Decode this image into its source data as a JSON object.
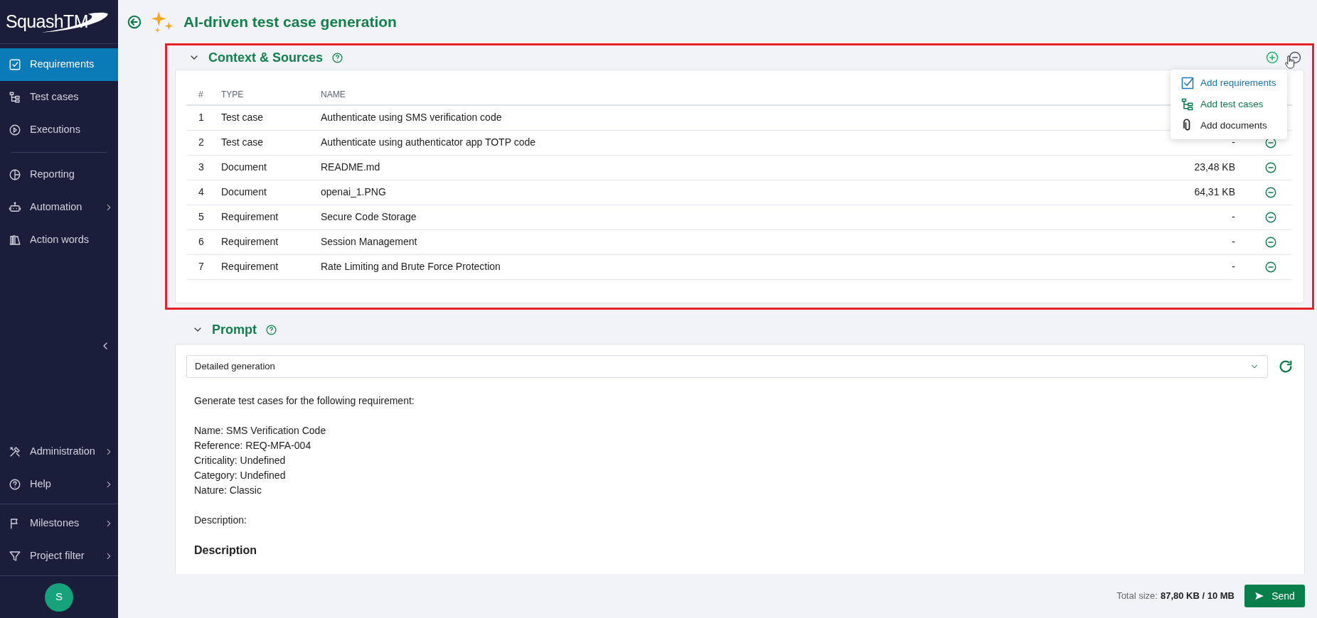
{
  "app": {
    "logo": "SquashTM",
    "avatar": "S"
  },
  "sidebar": {
    "sections": [
      [
        {
          "label": "Requirements",
          "selected": true,
          "submenu": false
        },
        {
          "label": "Test cases",
          "selected": false,
          "submenu": false
        },
        {
          "label": "Executions",
          "selected": false,
          "submenu": false
        }
      ],
      [
        {
          "label": "Reporting",
          "selected": false,
          "submenu": false
        },
        {
          "label": "Automation",
          "selected": false,
          "submenu": true
        },
        {
          "label": "Action words",
          "selected": false,
          "submenu": false
        }
      ],
      [
        {
          "label": "Administration",
          "selected": false,
          "submenu": true
        },
        {
          "label": "Help",
          "selected": false,
          "submenu": true
        }
      ],
      [
        {
          "label": "Milestones",
          "selected": false,
          "submenu": true
        },
        {
          "label": "Project filter",
          "selected": false,
          "submenu": true
        }
      ]
    ]
  },
  "page": {
    "title": "AI-driven test case generation"
  },
  "context": {
    "title": "Context & Sources",
    "expanded": true,
    "columns": [
      "#",
      "TYPE",
      "NAME"
    ],
    "rows": [
      {
        "number": "1",
        "type": "Test case",
        "name": "Authenticate using SMS verification code"
      },
      {
        "number": "2",
        "type": "Test case",
        "name": "Authenticate using authenticator app TOTP code",
        "size": "-"
      },
      {
        "number": "3",
        "type": "Document",
        "name": "README.md",
        "size": "23,48 KB"
      },
      {
        "number": "4",
        "type": "Document",
        "name": "openai_1.PNG",
        "size": "64,31 KB"
      },
      {
        "number": "5",
        "type": "Requirement",
        "name": "Secure Code Storage",
        "size": "-"
      },
      {
        "number": "6",
        "type": "Requirement",
        "name": "Session Management",
        "size": "-"
      },
      {
        "number": "7",
        "type": "Requirement",
        "name": "Rate Limiting and Brute Force Protection",
        "size": "-"
      }
    ],
    "add_menu": [
      {
        "label": "Add requirements",
        "kind": "requirements"
      },
      {
        "label": "Add test cases",
        "kind": "test_cases"
      },
      {
        "label": "Add documents",
        "kind": "documents"
      }
    ]
  },
  "prompt": {
    "title": "Prompt",
    "expanded": true,
    "template": "Detailed generation",
    "paragraphs": [
      [
        "Generate test cases for the following requirement:"
      ],
      [
        "Name: SMS Verification Code",
        "Reference: REQ-MFA-004",
        "Criticality: Undefined",
        "Category: Undefined",
        "Nature: Classic"
      ],
      [
        "Description:"
      ]
    ],
    "heading": "Description"
  },
  "footer": {
    "total_label": "Total size:",
    "total_value": "87,80 KB / 10 MB",
    "send": "Send"
  }
}
